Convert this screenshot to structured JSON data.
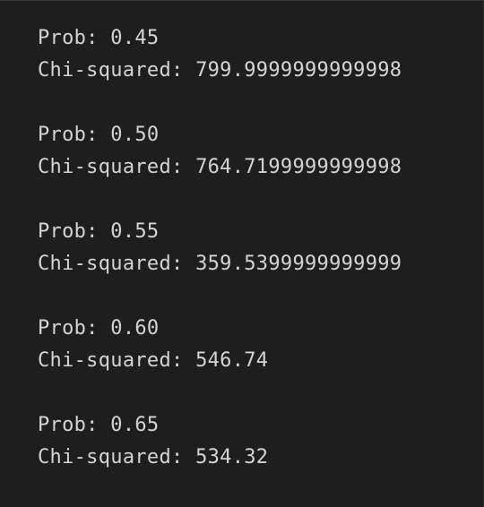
{
  "output": {
    "blocks": [
      {
        "prob_line": "Prob: 0.45",
        "chi_line": "Chi-squared: 799.9999999999998"
      },
      {
        "prob_line": "Prob: 0.50",
        "chi_line": "Chi-squared: 764.7199999999998"
      },
      {
        "prob_line": "Prob: 0.55",
        "chi_line": "Chi-squared: 359.5399999999999"
      },
      {
        "prob_line": "Prob: 0.60",
        "chi_line": "Chi-squared: 546.74"
      },
      {
        "prob_line": "Prob: 0.65",
        "chi_line": "Chi-squared: 534.32"
      }
    ]
  },
  "colors": {
    "background": "#1e1e1e",
    "text": "#d4d4d4"
  }
}
